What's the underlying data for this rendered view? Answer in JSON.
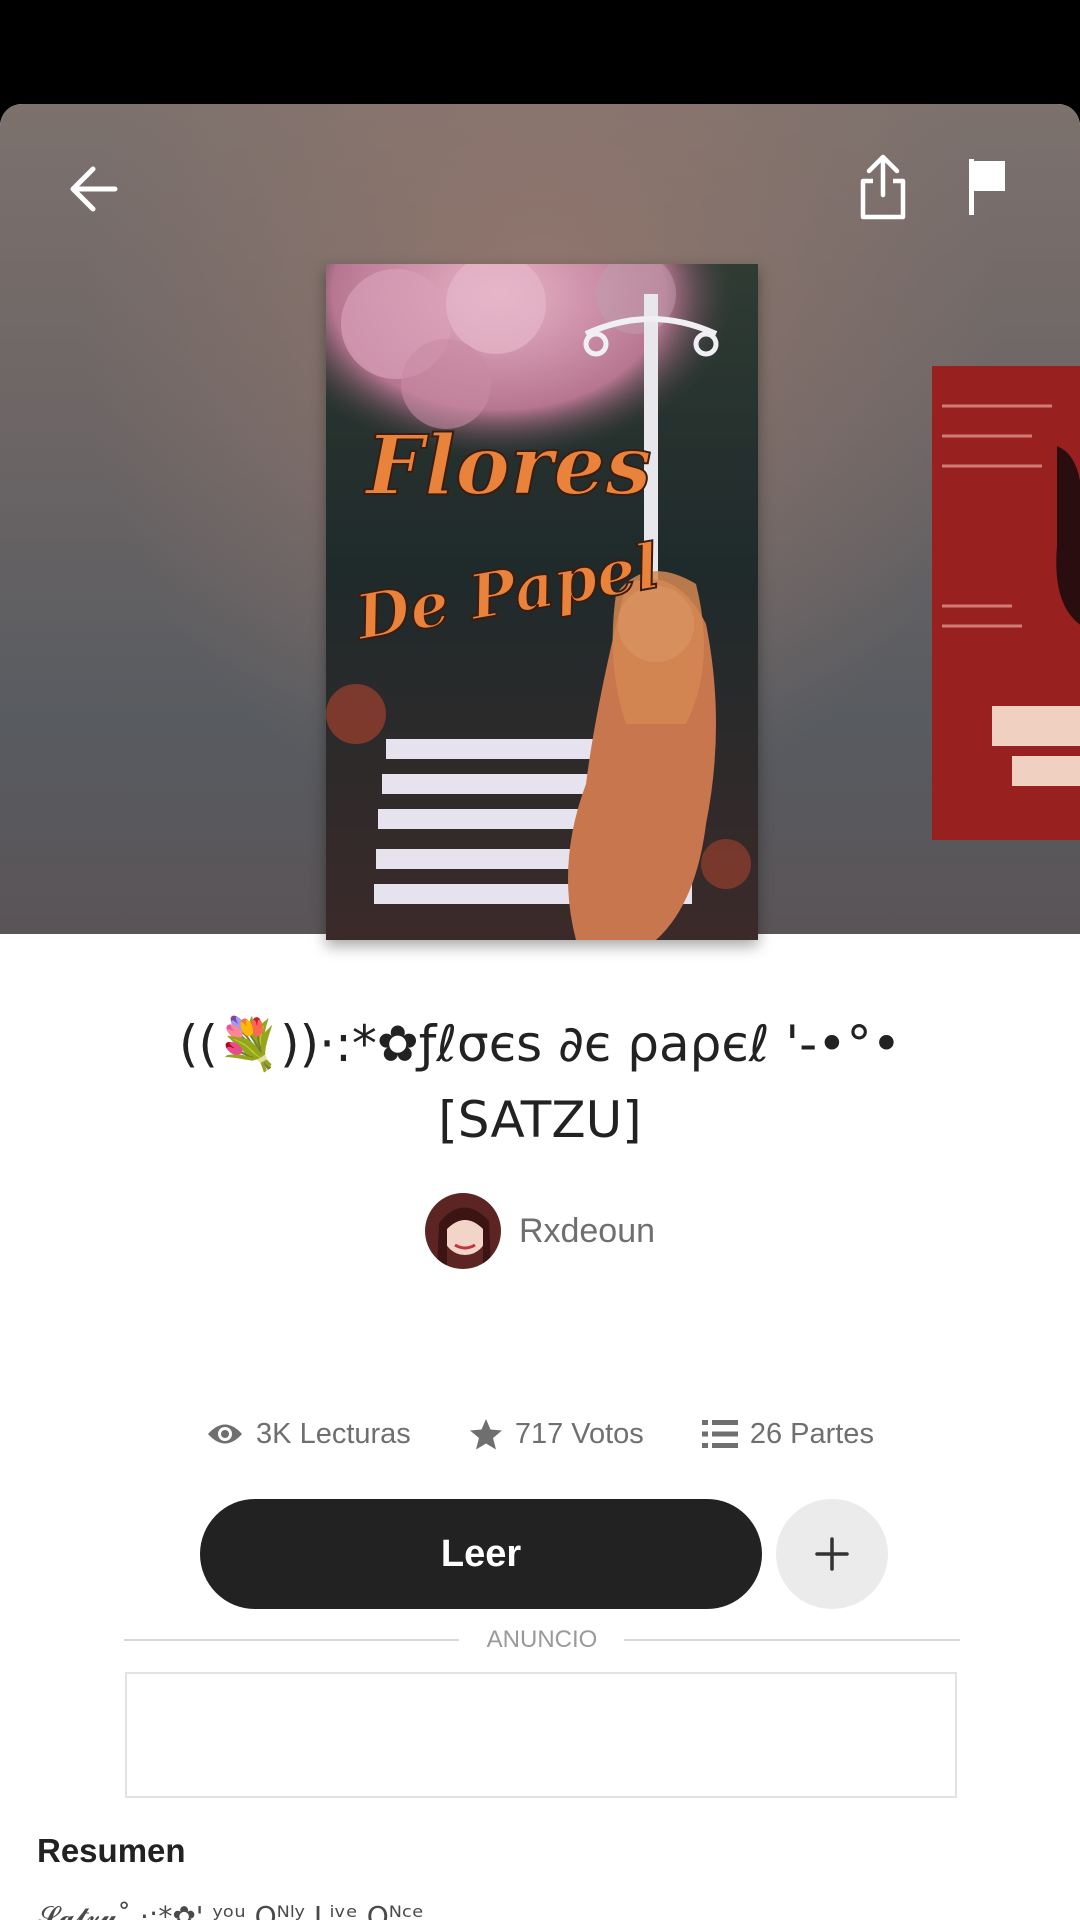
{
  "story": {
    "title_line1": "((💐))·:*✿ƒℓσєѕ ∂є ρaρєℓ '-•°•",
    "title_line2": "[SATZU]",
    "author": "Rxdeoun",
    "cover_text_line1": "Flores",
    "cover_text_line2": "De Papel"
  },
  "stats": {
    "reads": "3K Lecturas",
    "votes": "717 Votos",
    "parts": "26 Partes"
  },
  "actions": {
    "read_label": "Leer"
  },
  "ad": {
    "label": "ANUNCIO"
  },
  "summary": {
    "heading": "Resumen",
    "text": "𝓢𝓪𝓽𝔃𝓾˚ ·:*✿' ʸᵒᵘ Oᴺˡʸ Lⁱᵛᵉ Oᴺᶜᵉ"
  },
  "icons": {
    "back": "arrow-left-icon",
    "share": "share-icon",
    "report": "flag-icon",
    "reads": "eye-icon",
    "votes": "star-icon",
    "parts": "list-icon",
    "add": "plus-icon"
  },
  "colors": {
    "primary_button": "#222222",
    "secondary_button": "#ebebeb",
    "muted_text": "#6f6f6f"
  }
}
